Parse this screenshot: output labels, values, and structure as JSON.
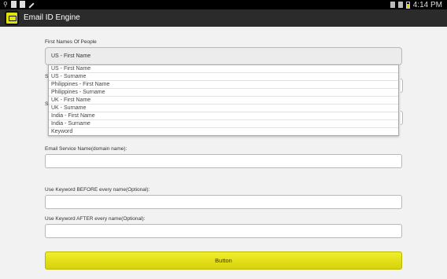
{
  "status_bar": {
    "time": "4:14 PM",
    "left_icons": [
      "usb-icon",
      "sd-card-icon",
      "image-icon",
      "pencil-icon"
    ],
    "right_icons": [
      "vibrate-icon",
      "bluetooth-icon",
      "battery-icon"
    ]
  },
  "action_bar": {
    "title": "Email ID Engine",
    "icon": "email-app-icon",
    "icon_color": "#dfe40b"
  },
  "form": {
    "first_names_label": "First Names Of People",
    "first_names_selected": "US - First Name",
    "dropdown_options": [
      "US - First Name",
      "US - Surname",
      "Philippines - First Name",
      "Philippines - Surname",
      "UK - First Name",
      "UK - Surname",
      "India - First Name",
      "India - Surname",
      "Keyword"
    ],
    "hidden_label_1": "S",
    "hidden_label_2": "S",
    "email_service_label": "Email Service Name(domain name):",
    "email_service_value": "",
    "keyword_before_label": "Use Keyword BEFORE every name(Optional):",
    "keyword_before_value": "",
    "keyword_after_label": "Use Keyword AFTER every name(Optional):",
    "keyword_after_value": "",
    "button_label": "Button",
    "button_color": "#e6e31a"
  }
}
